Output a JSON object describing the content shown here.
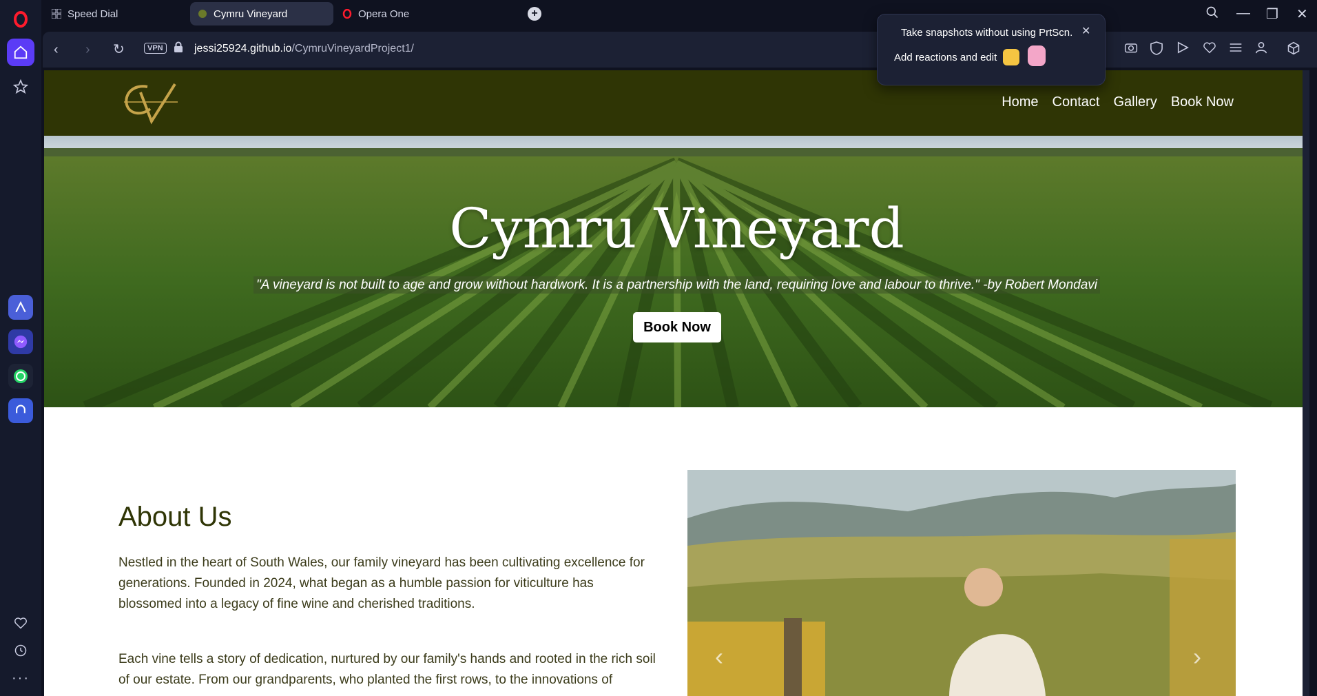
{
  "browser": {
    "tabs": [
      {
        "label": "Speed Dial"
      },
      {
        "label": "Cymru Vineyard"
      },
      {
        "label": "Opera One"
      }
    ],
    "vpn_label": "VPN",
    "url_host": "jessi25924.github.io",
    "url_path": "/CymruVineyardProject1/"
  },
  "popup": {
    "line1": "Take snapshots without using PrtScn.",
    "line2": "Add reactions and edit"
  },
  "site": {
    "nav": [
      "Home",
      "Contact",
      "Gallery",
      "Book Now"
    ],
    "hero_title": "Cymru Vineyard",
    "hero_quote": "\"A vineyard is not built to age and grow without hardwork. It is a partnership with the land, requiring love and labour to thrive.\" -by Robert Mondavi",
    "hero_button": "Book Now",
    "about_title": "About Us",
    "about_p1": "Nestled in the heart of South Wales, our family vineyard has been cultivating excellence for generations. Founded in 2024, what began as a humble passion for viticulture has blossomed into a legacy of fine wine and cherished traditions.",
    "about_p2": "Each vine tells a story of dedication, nurtured by our family's hands and rooted in the rich soil of our estate. From our grandparents, who planted the first rows, to the innovations of"
  },
  "colors": {
    "header_bg": "#2f3505",
    "accent": "#5b3cf6"
  }
}
